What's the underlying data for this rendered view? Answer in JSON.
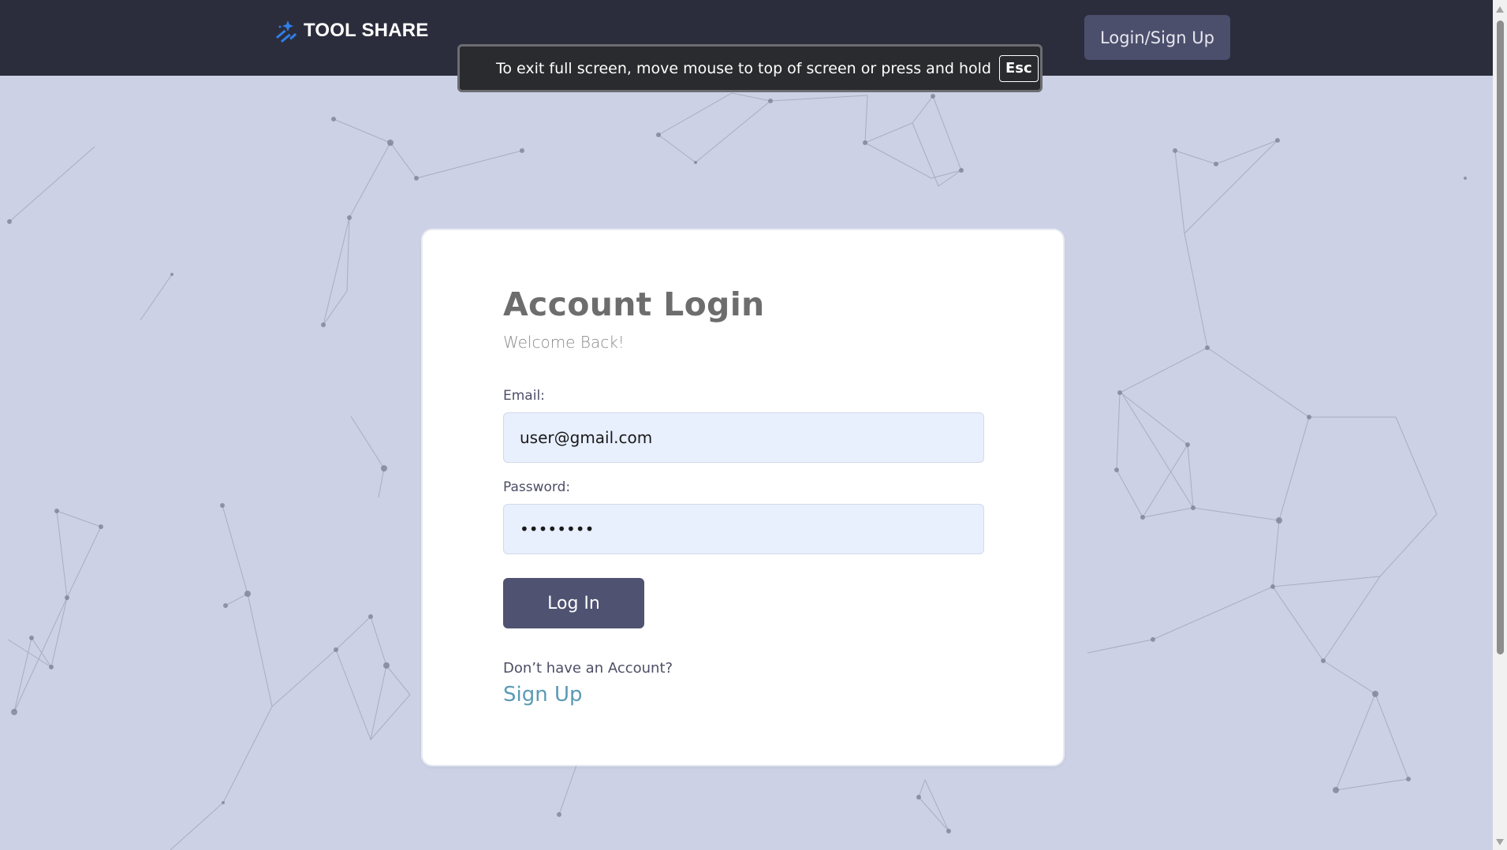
{
  "navbar": {
    "brand": "TOOL SHARE",
    "logo_icon": "sparkle-wand-icon",
    "auth_button_label": "Login/Sign Up"
  },
  "fullscreen_notice": {
    "text": "To exit full screen, move mouse to top of screen or press and hold",
    "key": "Esc"
  },
  "login_card": {
    "title": "Account Login",
    "subtitle": "Welcome Back!",
    "email_label": "Email:",
    "email_value": "user@gmail.com",
    "password_label": "Password:",
    "password_value": "••••••••",
    "submit_label": "Log In",
    "no_account_text": "Don’t have an Account?",
    "signup_link": "Sign Up"
  },
  "colors": {
    "navbar_bg": "#2c2d3c",
    "page_bg": "#ccd1e5",
    "button_bg": "#4f5270",
    "link": "#5a9ab5",
    "input_bg": "#e8effd",
    "brand_icon": "#2f7fe8"
  }
}
